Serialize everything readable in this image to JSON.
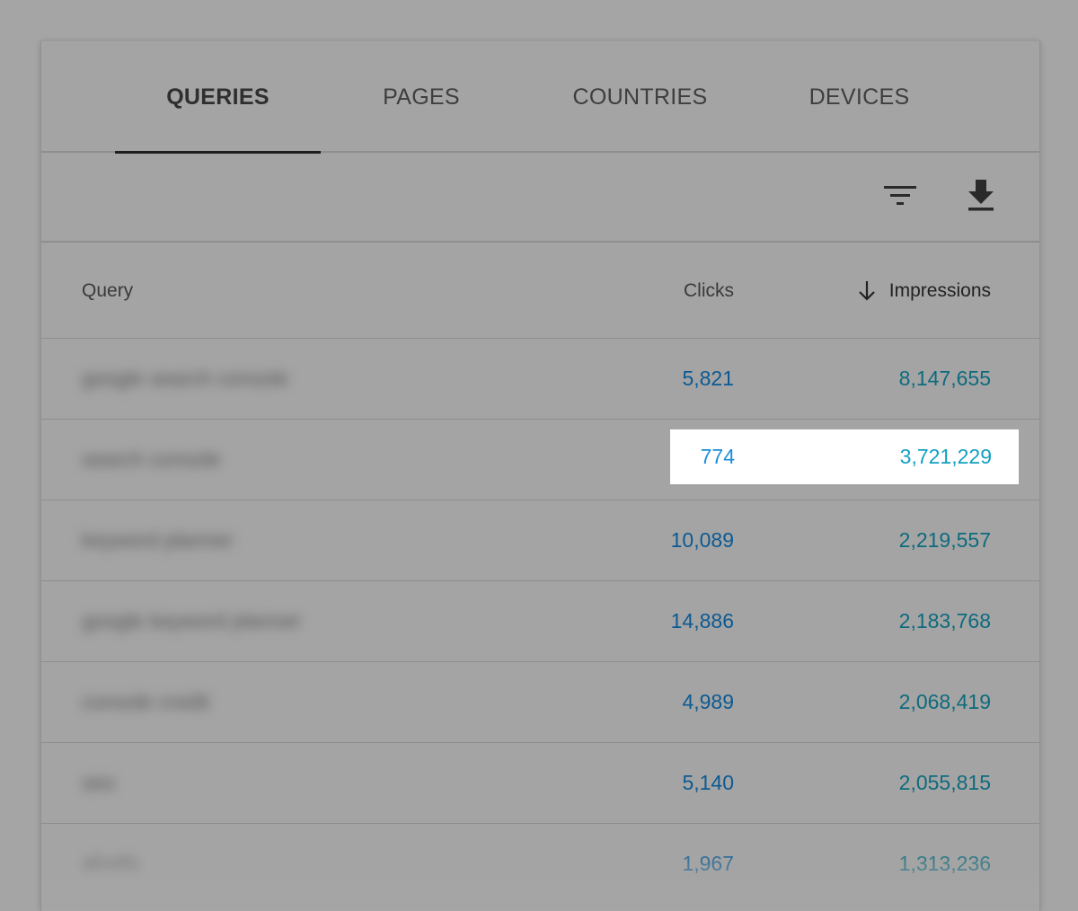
{
  "tabs": [
    {
      "label": "QUERIES",
      "active": true
    },
    {
      "label": "PAGES",
      "active": false
    },
    {
      "label": "COUNTRIES",
      "active": false
    },
    {
      "label": "DEVICES",
      "active": false
    }
  ],
  "toolbar": {
    "filter_icon": "filter-icon",
    "download_icon": "download-icon"
  },
  "table": {
    "headers": {
      "query": "Query",
      "clicks": "Clicks",
      "impressions": "Impressions",
      "sort_icon": "arrow-down-icon"
    },
    "rows": [
      {
        "query": "google search console",
        "clicks": "5,821",
        "impressions": "8,147,655"
      },
      {
        "query": "search console",
        "clicks": "774",
        "impressions": "3,721,229",
        "highlighted": true
      },
      {
        "query": "keyword planner",
        "clicks": "10,089",
        "impressions": "2,219,557"
      },
      {
        "query": "google keyword planner",
        "clicks": "14,886",
        "impressions": "2,183,768"
      },
      {
        "query": "console credit",
        "clicks": "4,989",
        "impressions": "2,068,419"
      },
      {
        "query": "seo",
        "clicks": "5,140",
        "impressions": "2,055,815"
      },
      {
        "query": "ahrefs",
        "clicks": "1,967",
        "impressions": "1,313,236"
      }
    ]
  },
  "colors": {
    "clicks": "#0c5a93",
    "impressions": "#0d6b7d",
    "highlight_clicks": "#1d8ed8",
    "highlight_impressions": "#13a0c0",
    "overlay": "#a5a5a5"
  }
}
